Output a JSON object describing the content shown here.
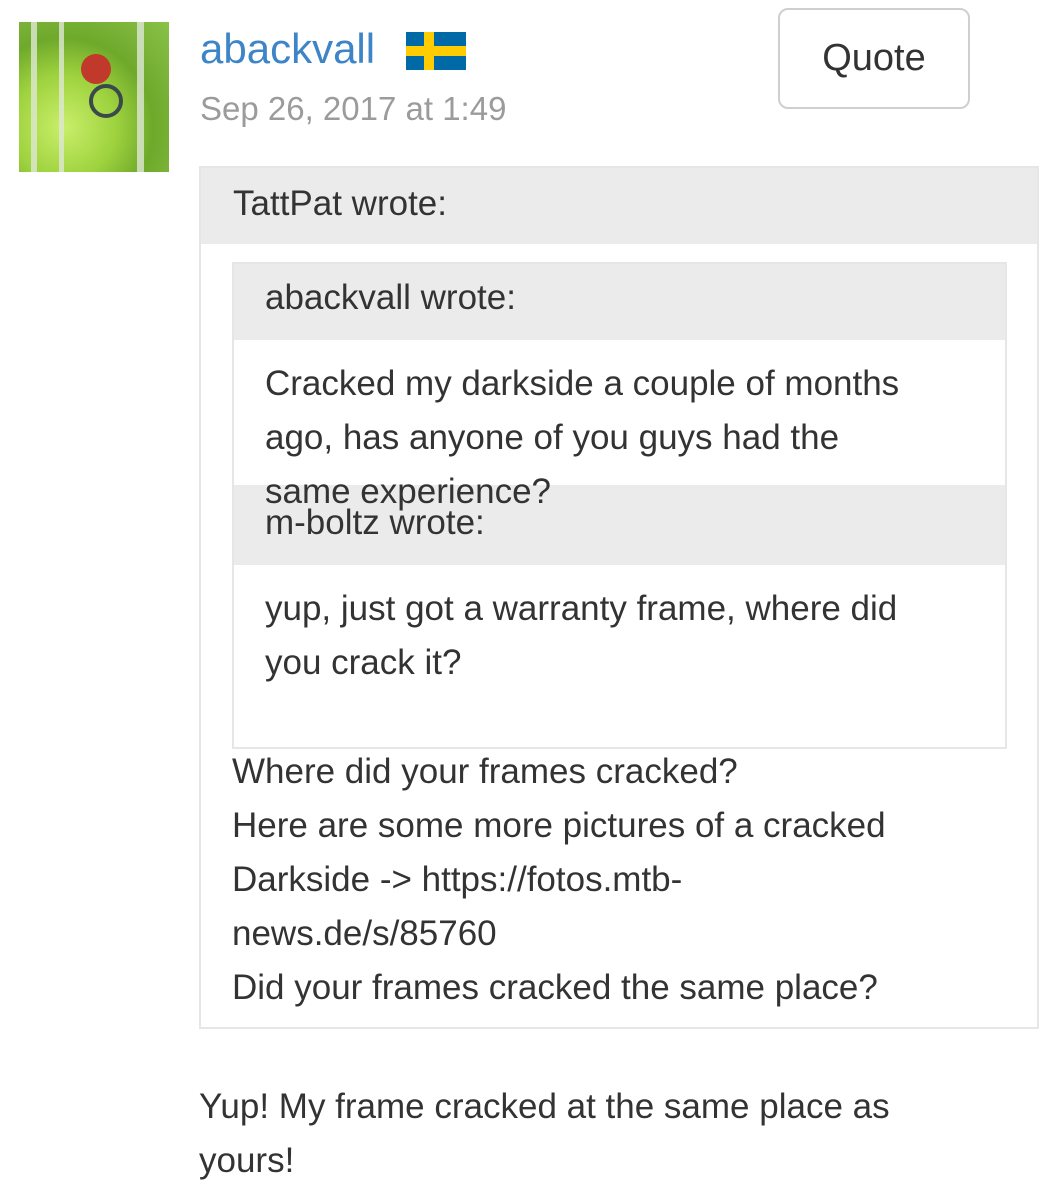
{
  "post": {
    "author": "abackvall",
    "timestamp": "Sep 26, 2017 at 1:49",
    "quote_button": "Quote",
    "flag": "sweden-flag",
    "colors": {
      "username": "#3d85c6",
      "timestamp": "#9b9b9b",
      "quote_header_bg": "#ebebeb"
    }
  },
  "outer_quote": {
    "header": "TattPat wrote:",
    "inner_quote": {
      "header": "abackvall wrote:",
      "body_lines": [
        "Cracked my darkside a couple of months",
        "ago, has anyone of you guys had the",
        "same experience?"
      ],
      "nested_header": "m-boltz wrote:",
      "nested_body_lines": [
        "yup, just got a warranty frame, where did",
        "you crack it?"
      ]
    },
    "body_lines": [
      "Where did your frames cracked?",
      "Here are some more pictures of a cracked",
      "Darkside -> https://fotos.mtb-",
      "news.de/s/85760",
      "Did your frames cracked the same place?"
    ]
  },
  "reply_lines": [
    "Yup! My frame cracked at the same place as",
    "yours!"
  ]
}
